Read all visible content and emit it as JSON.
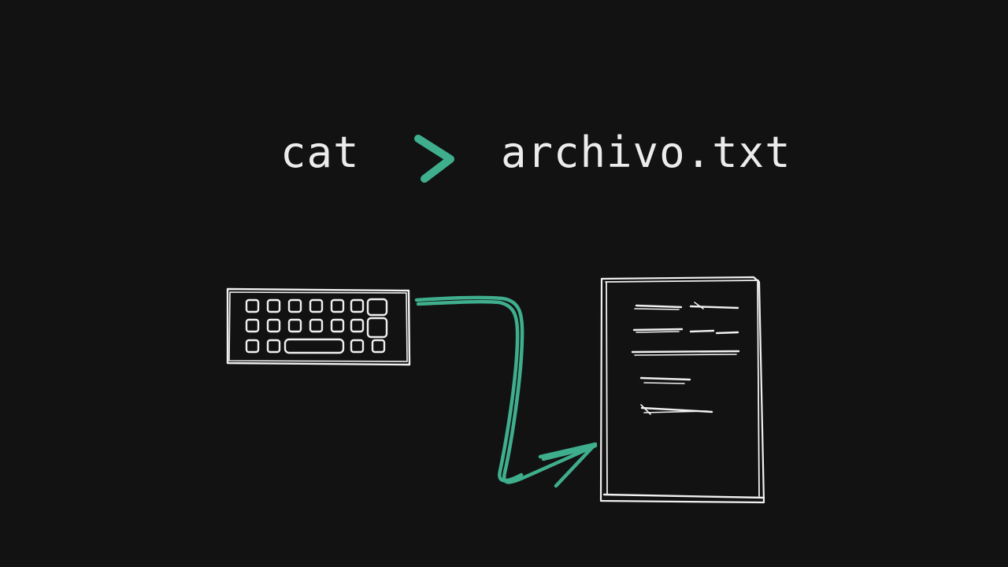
{
  "command": {
    "program": "cat",
    "operator": "redirect-output",
    "target": "archivo.txt"
  },
  "colors": {
    "background": "#121212",
    "text": "#ececec",
    "accent": "#3fae8c",
    "sketch": "#f0f0f0"
  },
  "icons": [
    "redirect-chevron-icon",
    "keyboard-icon",
    "flow-arrow-icon",
    "text-file-icon"
  ]
}
